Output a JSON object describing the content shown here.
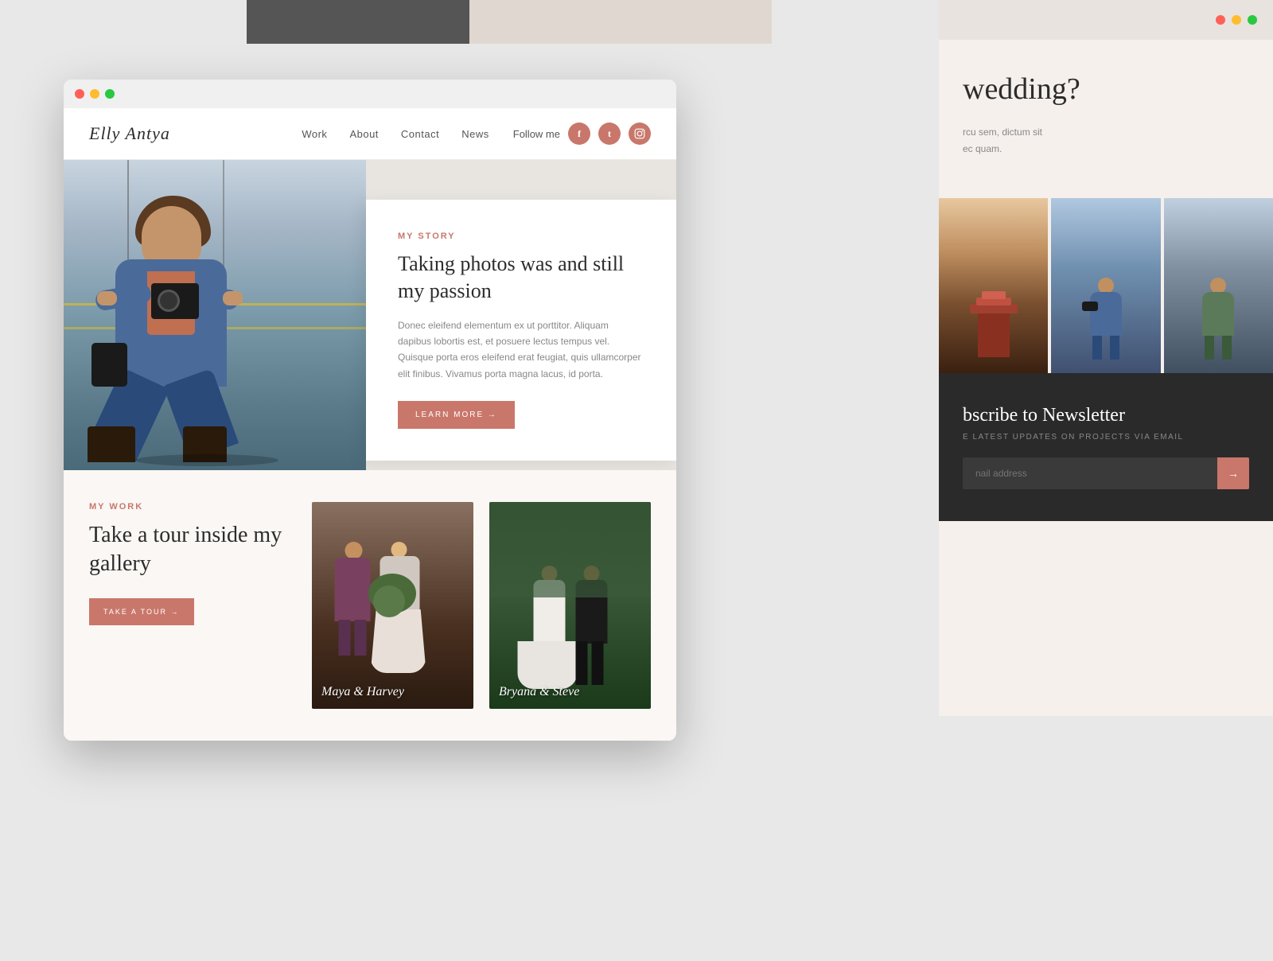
{
  "page": {
    "background": "#e0ddd8"
  },
  "browser": {
    "dots": [
      "#ff6057",
      "#ffbc2e",
      "#29c841"
    ]
  },
  "nav": {
    "logo": "Elly Antya",
    "links": [
      "Work",
      "About",
      "Contact",
      "News"
    ],
    "follow_label": "Follow me",
    "social_icons": [
      "f",
      "t",
      "in"
    ]
  },
  "hero": {
    "story_tag": "MY STORY",
    "story_title": "Taking photos was and still my passion",
    "story_body": "Donec eleifend elementum ex ut porttitor. Aliquam dapibus lobortis est, et posuere lectus tempus vel. Quisque porta eros eleifend erat feugiat, quis ullamcorper elit finibus. Vivamus porta magna lacus, id porta.",
    "learn_btn": "LEARN MORE →"
  },
  "work_section": {
    "tag": "MY WORK",
    "title": "Take a tour inside my gallery",
    "tour_btn": "TAKE A TOUR →"
  },
  "gallery": {
    "items": [
      {
        "label": "Maya & Harvey"
      },
      {
        "label": "Bryana & Steve"
      }
    ]
  },
  "second_window": {
    "wedding_heading": "wedding?",
    "wedding_para_1": "rcu sem, dictum sit",
    "wedding_para_2": "ec quam.",
    "newsletter_title": "bscribe to Newsletter",
    "newsletter_subtitle": "E LATEST UPDATES ON PROJECTS VIA EMAIL",
    "email_placeholder": "nail address",
    "submit_icon": "→"
  }
}
